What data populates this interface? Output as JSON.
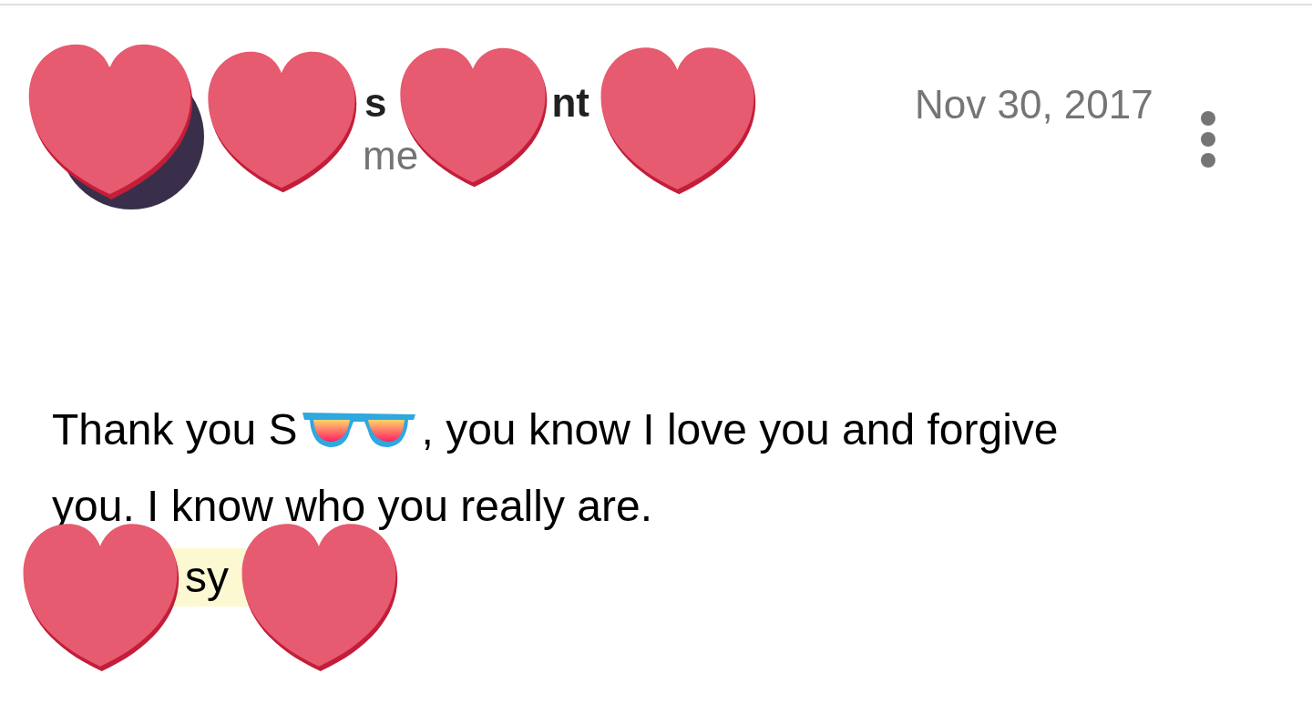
{
  "message": {
    "sender_name_fragments": [
      "s",
      "nt"
    ],
    "recipient": "me",
    "date": "Nov 30, 2017",
    "body": {
      "line_1_before_sticker": "Thank you S",
      "line_1_after_sticker": ", you know I love you and forgive",
      "line_2": "you. I know who you really are."
    },
    "signature_fragment": "sy"
  }
}
